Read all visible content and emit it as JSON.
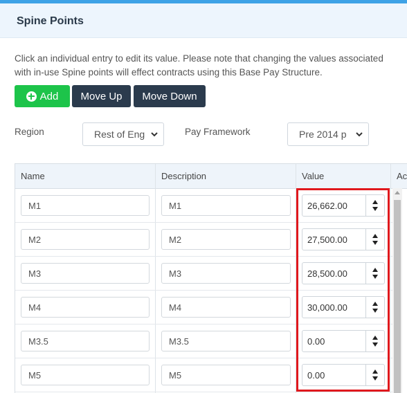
{
  "panel": {
    "title": "Spine Points"
  },
  "note": "Click an individual entry to edit its value. Please note that changing the values associated with in-use Spine points will effect contracts using this Base Pay Structure.",
  "toolbar": {
    "add_label": "Add",
    "move_up_label": "Move Up",
    "move_down_label": "Move Down"
  },
  "filters": {
    "region_label": "Region",
    "region_value": "Rest of Eng",
    "framework_label": "Pay Framework",
    "framework_value": "Pre 2014 p"
  },
  "table": {
    "columns": [
      "Name",
      "Description",
      "Value",
      "Ac"
    ],
    "rows": [
      {
        "name": "M1",
        "description": "M1",
        "value": "26,662.00"
      },
      {
        "name": "M2",
        "description": "M2",
        "value": "27,500.00"
      },
      {
        "name": "M3",
        "description": "M3",
        "value": "28,500.00"
      },
      {
        "name": "M4",
        "description": "M4",
        "value": "30,000.00"
      },
      {
        "name": "M3.5",
        "description": "M3.5",
        "value": "0.00"
      },
      {
        "name": "M5",
        "description": "M5",
        "value": "0.00"
      }
    ]
  },
  "colors": {
    "accent": "#3ea2e6",
    "add_button": "#1dc44a",
    "dark_button": "#2b3b4d",
    "highlight": "#e0181d"
  },
  "icons": {
    "add": "plus-circle-icon",
    "select": "chevron-down-icon",
    "spinner": "up-down-arrows-icon"
  }
}
